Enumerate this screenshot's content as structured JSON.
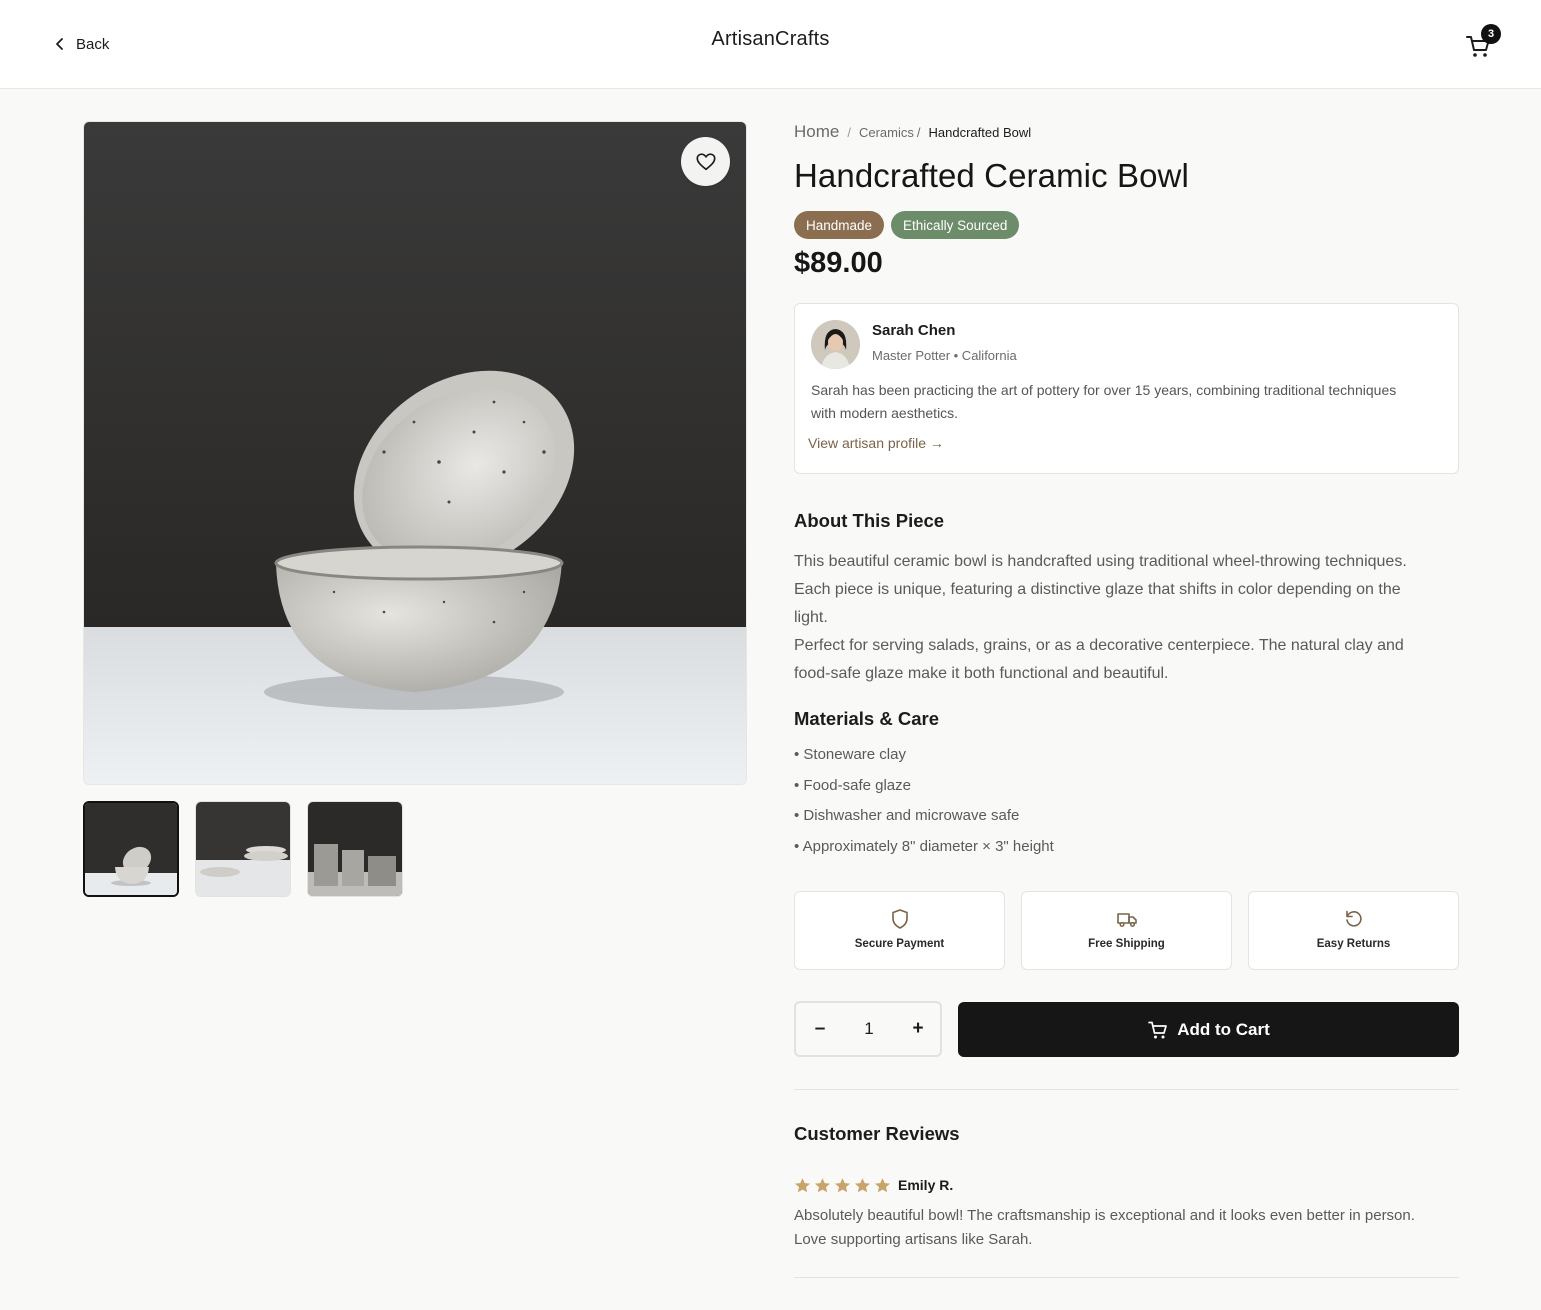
{
  "header": {
    "back_label": "Back",
    "brand": "ArtisanCrafts",
    "cart_count": "3"
  },
  "gallery": {
    "thumbnails": [
      "bowl-front",
      "bowls-stacked",
      "cups-set"
    ],
    "active_index": 0
  },
  "breadcrumb": {
    "home": "Home",
    "category": "Ceramics",
    "sep1": "/",
    "sep2": "/",
    "current": "Handcrafted Bowl"
  },
  "product": {
    "title": "Handcrafted Ceramic Bowl",
    "badges": [
      "Handmade",
      "Ethically Sourced"
    ],
    "price": "$89.00"
  },
  "artisan": {
    "name": "Sarah Chen",
    "role": "Master Potter • California",
    "bio": "Sarah has been practicing the art of pottery for over 15 years, combining traditional techniques with modern aesthetics.",
    "link": "View artisan profile →"
  },
  "about": {
    "heading": "About This Piece",
    "paragraph1": "This beautiful ceramic bowl is handcrafted using traditional wheel-throwing techniques. Each piece is unique, featuring a distinctive glaze that shifts in color depending on the light.",
    "paragraph2": "Perfect for serving salads, grains, or as a decorative centerpiece. The natural clay and food-safe glaze make it both functional and beautiful."
  },
  "materials": {
    "heading": "Materials & Care",
    "items": [
      "• Stoneware clay",
      "• Food-safe glaze",
      "• Dishwasher and microwave safe",
      "• Approximately 8\" diameter × 3\" height"
    ]
  },
  "features": [
    {
      "label": "Secure Payment",
      "icon": "shield-icon"
    },
    {
      "label": "Free Shipping",
      "icon": "truck-icon"
    },
    {
      "label": "Easy Returns",
      "icon": "rotate-icon"
    }
  ],
  "purchase": {
    "minus": "–",
    "quantity": "1",
    "plus": "+",
    "add_to_cart": "Add to Cart"
  },
  "reviews": {
    "heading": "Customer Reviews",
    "items": [
      {
        "rating": 5,
        "author": "Emily R.",
        "text": "Absolutely beautiful bowl! The craftsmanship is exceptional and it looks even better in person. Love supporting artisans like Sarah."
      }
    ]
  },
  "colors": {
    "accent_brown": "#8b6e50",
    "accent_green": "#6c8c6a",
    "star": "#c9a46a",
    "button_dark": "#161616"
  }
}
